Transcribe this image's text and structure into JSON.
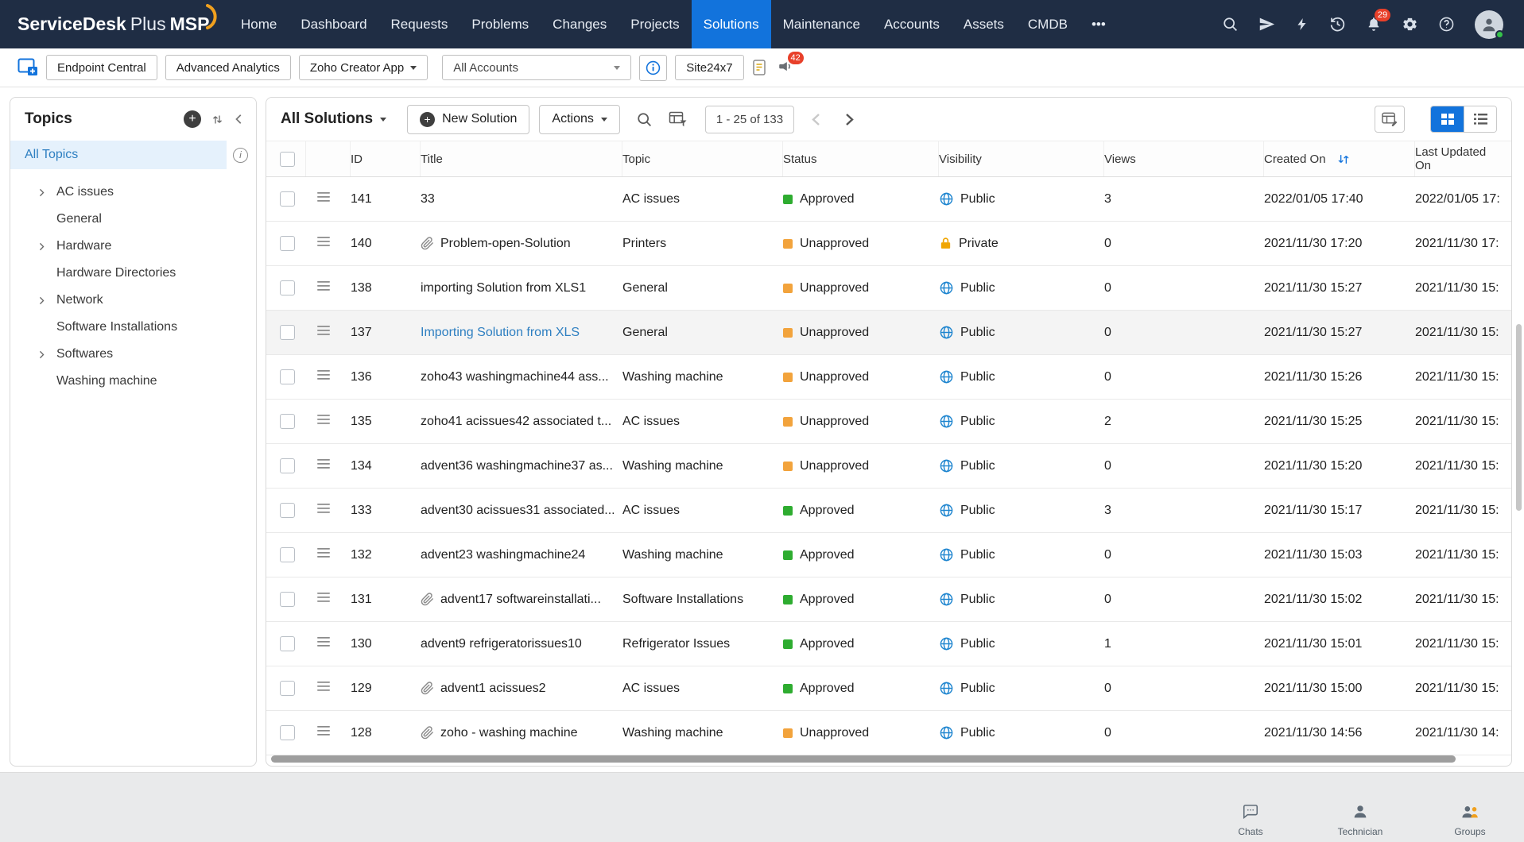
{
  "colors": {
    "accent_blue": "#1273dc",
    "approved_green": "#2eac30",
    "unapproved_orange": "#f2a33c",
    "link_blue": "#2e7fc1",
    "public_globe_blue": "#1e85cf",
    "private_lock_orange": "#f0a500",
    "badge_red": "#e8402a"
  },
  "navbar": {
    "brand": {
      "name": "ServiceDesk",
      "plus": "Plus",
      "msp": "MSP"
    },
    "items": [
      {
        "label": "Home"
      },
      {
        "label": "Dashboard"
      },
      {
        "label": "Requests"
      },
      {
        "label": "Problems"
      },
      {
        "label": "Changes"
      },
      {
        "label": "Projects"
      },
      {
        "label": "Solutions",
        "active": true
      },
      {
        "label": "Maintenance"
      },
      {
        "label": "Accounts"
      },
      {
        "label": "Assets"
      },
      {
        "label": "CMDB"
      },
      {
        "label": "•••",
        "name": "more"
      }
    ],
    "notifications_badge": "29"
  },
  "toolbar": {
    "endpoint_central_label": "Endpoint Central",
    "advanced_analytics_label": "Advanced Analytics",
    "zoho_creator_label": "Zoho Creator App",
    "all_accounts_value": "All Accounts",
    "site24x7_label": "Site24x7",
    "announcements_badge": "42"
  },
  "sidebar": {
    "title": "Topics",
    "all_topics_label": "All Topics",
    "items": [
      {
        "label": "AC issues",
        "expandable": true
      },
      {
        "label": "General",
        "expandable": false
      },
      {
        "label": "Hardware",
        "expandable": true
      },
      {
        "label": "Hardware Directories",
        "expandable": false
      },
      {
        "label": "Network",
        "expandable": true
      },
      {
        "label": "Software Installations",
        "expandable": false
      },
      {
        "label": "Softwares",
        "expandable": true
      },
      {
        "label": "Washing machine",
        "expandable": false
      }
    ]
  },
  "main": {
    "view_title": "All Solutions",
    "new_solution_label": "New Solution",
    "actions_label": "Actions",
    "pagination_text": "1 - 25 of 133",
    "table": {
      "columns": [
        "ID",
        "Title",
        "Topic",
        "Status",
        "Visibility",
        "Views",
        "Created On",
        "Last Updated On"
      ],
      "rows": [
        {
          "id": "141",
          "title": "33",
          "topic": "AC issues",
          "status": "Approved",
          "status_type": "approved",
          "visibility": "Public",
          "visibility_type": "public",
          "views": "3",
          "created": "2022/01/05 17:40",
          "updated": "2022/01/05 17:"
        },
        {
          "id": "140",
          "title": "Problem-open-Solution",
          "attachment": true,
          "topic": "Printers",
          "status": "Unapproved",
          "status_type": "unapproved",
          "visibility": "Private",
          "visibility_type": "private",
          "views": "0",
          "created": "2021/11/30 17:20",
          "updated": "2021/11/30 17:"
        },
        {
          "id": "138",
          "title": "importing Solution from XLS1",
          "topic": "General",
          "status": "Unapproved",
          "status_type": "unapproved",
          "visibility": "Public",
          "visibility_type": "public",
          "views": "0",
          "created": "2021/11/30 15:27",
          "updated": "2021/11/30 15:"
        },
        {
          "id": "137",
          "title": "Importing Solution from XLS",
          "link": true,
          "highlighted": true,
          "topic": "General",
          "status": "Unapproved",
          "status_type": "unapproved",
          "visibility": "Public",
          "visibility_type": "public",
          "views": "0",
          "created": "2021/11/30 15:27",
          "updated": "2021/11/30 15:"
        },
        {
          "id": "136",
          "title": "zoho43 washingmachine44 ass...",
          "topic": "Washing machine",
          "status": "Unapproved",
          "status_type": "unapproved",
          "visibility": "Public",
          "visibility_type": "public",
          "views": "0",
          "created": "2021/11/30 15:26",
          "updated": "2021/11/30 15:"
        },
        {
          "id": "135",
          "title": "zoho41 acissues42 associated t...",
          "topic": "AC issues",
          "status": "Unapproved",
          "status_type": "unapproved",
          "visibility": "Public",
          "visibility_type": "public",
          "views": "2",
          "created": "2021/11/30 15:25",
          "updated": "2021/11/30 15:"
        },
        {
          "id": "134",
          "title": "advent36 washingmachine37 as...",
          "topic": "Washing machine",
          "status": "Unapproved",
          "status_type": "unapproved",
          "visibility": "Public",
          "visibility_type": "public",
          "views": "0",
          "created": "2021/11/30 15:20",
          "updated": "2021/11/30 15:"
        },
        {
          "id": "133",
          "title": "advent30 acissues31 associated...",
          "topic": "AC issues",
          "status": "Approved",
          "status_type": "approved",
          "visibility": "Public",
          "visibility_type": "public",
          "views": "3",
          "created": "2021/11/30 15:17",
          "updated": "2021/11/30 15:"
        },
        {
          "id": "132",
          "title": "advent23  washingmachine24",
          "topic": "Washing machine",
          "status": "Approved",
          "status_type": "approved",
          "visibility": "Public",
          "visibility_type": "public",
          "views": "0",
          "created": "2021/11/30 15:03",
          "updated": "2021/11/30 15:"
        },
        {
          "id": "131",
          "title": "advent17  softwareinstallati...",
          "attachment": true,
          "topic": "Software Installations",
          "status": "Approved",
          "status_type": "approved",
          "visibility": "Public",
          "visibility_type": "public",
          "views": "0",
          "created": "2021/11/30 15:02",
          "updated": "2021/11/30 15:"
        },
        {
          "id": "130",
          "title": "advent9 refrigeratorissues10",
          "topic": "Refrigerator Issues",
          "status": "Approved",
          "status_type": "approved",
          "visibility": "Public",
          "visibility_type": "public",
          "views": "1",
          "created": "2021/11/30 15:01",
          "updated": "2021/11/30 15:"
        },
        {
          "id": "129",
          "title": "advent1 acissues2",
          "attachment": true,
          "topic": "AC issues",
          "status": "Approved",
          "status_type": "approved",
          "visibility": "Public",
          "visibility_type": "public",
          "views": "0",
          "created": "2021/11/30 15:00",
          "updated": "2021/11/30 15:"
        },
        {
          "id": "128",
          "title": "zoho - washing machine",
          "attachment": true,
          "topic": "Washing machine",
          "status": "Unapproved",
          "status_type": "unapproved",
          "visibility": "Public",
          "visibility_type": "public",
          "views": "0",
          "created": "2021/11/30 14:56",
          "updated": "2021/11/30 14:"
        }
      ]
    }
  },
  "footer": {
    "items": [
      {
        "label": "Chats"
      },
      {
        "label": "Technician"
      },
      {
        "label": "Groups"
      }
    ]
  }
}
